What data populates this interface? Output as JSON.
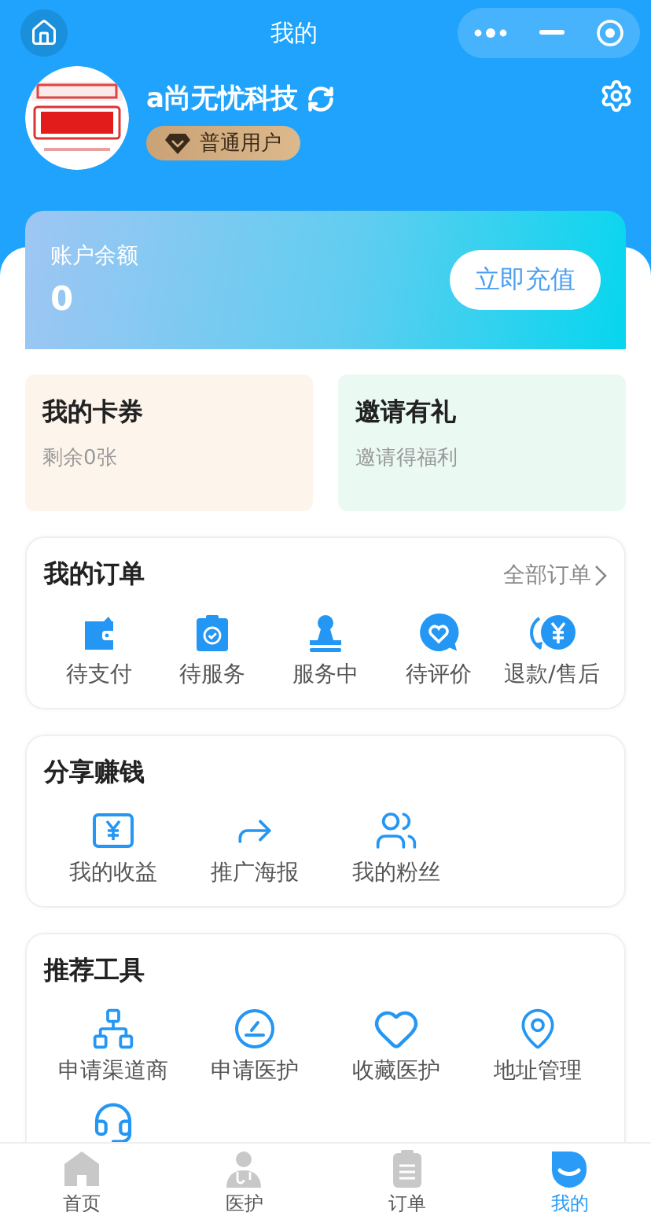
{
  "header": {
    "title": "我的"
  },
  "profile": {
    "name": "a尚无忧科技",
    "level": "普通用户"
  },
  "balance": {
    "label": "账户余额",
    "amount": "0",
    "button": "立即充值"
  },
  "promo_cards": [
    {
      "title": "我的卡券",
      "subtitle": "剩余0张",
      "color": "#fdf5ec"
    },
    {
      "title": "邀请有礼",
      "subtitle": "邀请得福利",
      "color": "#ebf9f3"
    }
  ],
  "orders": {
    "title": "我的订单",
    "link": "全部订单",
    "items": [
      {
        "label": "待支付",
        "kind": "wallet"
      },
      {
        "label": "待服务",
        "kind": "clipboard"
      },
      {
        "label": "服务中",
        "kind": "stamp"
      },
      {
        "label": "待评价",
        "kind": "chat"
      },
      {
        "label": "退款/售后",
        "kind": "refund"
      }
    ]
  },
  "share": {
    "title": "分享赚钱",
    "items": [
      {
        "label": "我的收益",
        "kind": "earnings"
      },
      {
        "label": "推广海报",
        "kind": "share"
      },
      {
        "label": "我的粉丝",
        "kind": "fans"
      }
    ]
  },
  "tools": {
    "title": "推荐工具",
    "items": [
      {
        "label": "申请渠道商",
        "kind": "channel"
      },
      {
        "label": "申请医护",
        "kind": "apply"
      },
      {
        "label": "收藏医护",
        "kind": "favorite"
      },
      {
        "label": "地址管理",
        "kind": "address"
      },
      {
        "kind": "support"
      }
    ]
  },
  "tab_bar": [
    {
      "label": "首页",
      "kind": "home",
      "selected": false
    },
    {
      "label": "医护",
      "kind": "doctor",
      "selected": false
    },
    {
      "label": "订单",
      "kind": "orders",
      "selected": false
    },
    {
      "label": "我的",
      "kind": "me",
      "selected": true
    }
  ]
}
